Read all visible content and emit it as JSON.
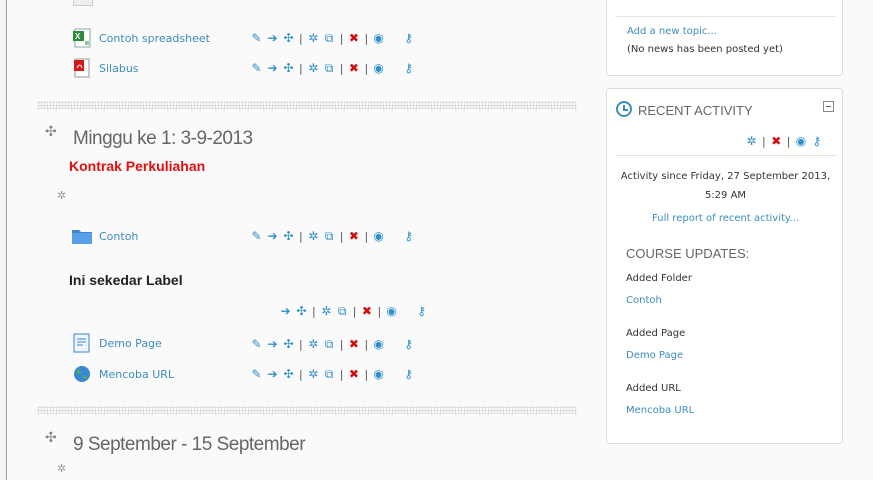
{
  "main": {
    "resources_top": [
      {
        "name": "Contoh spreadsheet",
        "icon": "spreadsheet-icon"
      },
      {
        "name": "Silabus",
        "icon": "pdf-icon"
      }
    ],
    "section1": {
      "title": "Minggu ke 1: 3-9-2013",
      "summary": "Kontrak Perkuliahan",
      "folder": {
        "name": "Contoh",
        "icon": "folder-icon"
      },
      "label_text": "Ini sekedar Label",
      "resources": [
        {
          "name": "Demo Page",
          "icon": "page-icon"
        },
        {
          "name": "Mencoba URL",
          "icon": "url-globe-icon"
        }
      ]
    },
    "section2": {
      "title": "9 September - 15 September"
    }
  },
  "sidebar": {
    "news": {
      "add_topic": "Add a new topic...",
      "no_news": "(No news has been posted yet)"
    },
    "recent": {
      "title": "RECENT ACTIVITY",
      "since_line1": "Activity since Friday, 27 September 2013,",
      "since_line2": "5:29 AM",
      "full_report": "Full report of recent activity...",
      "course_updates": "COURSE UPDATES:",
      "updates": [
        {
          "label": "Added Folder",
          "item": "Contoh"
        },
        {
          "label": "Added Page",
          "item": "Demo Page"
        },
        {
          "label": "Added URL",
          "item": "Mencoba URL"
        }
      ]
    }
  },
  "colors": {
    "link": "#3b8dbd",
    "summary_red": "#e01010",
    "delete_red": "#d01010"
  }
}
